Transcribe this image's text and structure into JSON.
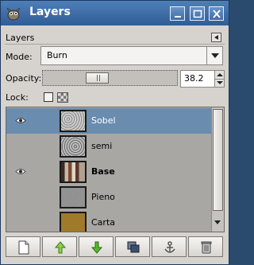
{
  "window": {
    "title": "Layers"
  },
  "panel": {
    "title": "Layers"
  },
  "mode": {
    "label": "Mode:",
    "value": "Burn"
  },
  "opacity": {
    "label": "Opacity:",
    "value": "38.2",
    "level_percent": 38.2
  },
  "lock": {
    "label": "Lock:"
  },
  "layers": [
    {
      "name": "Sobel",
      "visible": true,
      "selected": true,
      "bold": false,
      "thumb": "sobel-texture"
    },
    {
      "name": "semi",
      "visible": false,
      "selected": false,
      "bold": false,
      "thumb": "semi-texture"
    },
    {
      "name": "Base",
      "visible": true,
      "selected": false,
      "bold": true,
      "thumb": "building-photo"
    },
    {
      "name": "Pieno",
      "visible": false,
      "selected": false,
      "bold": false,
      "thumb": "gray-noise"
    },
    {
      "name": "Carta",
      "visible": false,
      "selected": false,
      "bold": false,
      "thumb": "brown-paper"
    }
  ],
  "toolbar": [
    "new-layer-icon",
    "raise-layer-icon",
    "lower-layer-icon",
    "duplicate-layer-icon",
    "anchor-layer-icon",
    "delete-layer-icon"
  ],
  "colors": {
    "titlebar": "#3c6aa5",
    "selection": "#6a8caf",
    "list_bg": "#a9a7a4",
    "raise_arrow": "#8ccf4b",
    "lower_arrow": "#55b82d"
  }
}
